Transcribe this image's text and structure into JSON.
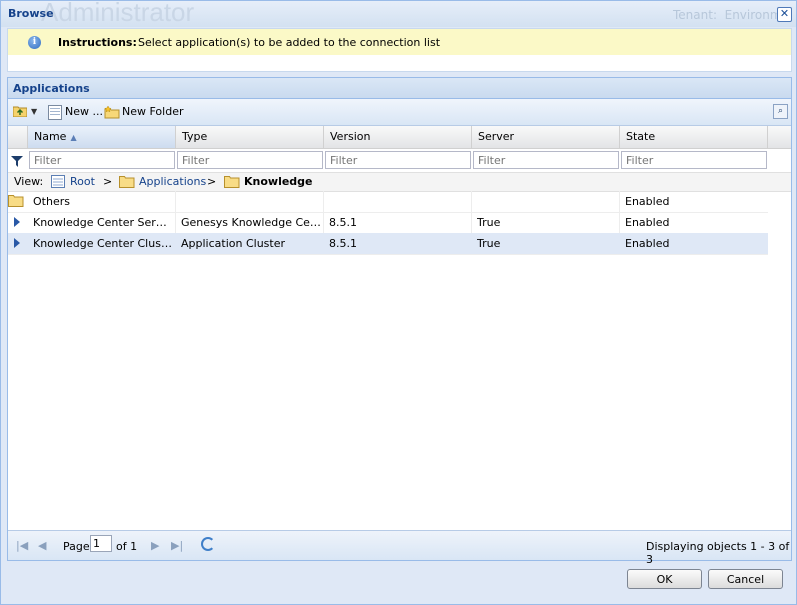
{
  "window": {
    "title": "Browse",
    "background_app_title": "Administrator",
    "background_tenant_text": "Tenant:  Environm",
    "close_glyph": "✕"
  },
  "instructions": {
    "label": "Instructions:",
    "text": "Select application(s) to be added to the connection list"
  },
  "panel": {
    "title": "Applications"
  },
  "toolbar": {
    "new_label": "New ...",
    "new_folder_label": "New Folder"
  },
  "columns": [
    {
      "label": "Name"
    },
    {
      "label": "Type"
    },
    {
      "label": "Version"
    },
    {
      "label": "Server"
    },
    {
      "label": "State"
    }
  ],
  "filters": {
    "placeholder": "Filter"
  },
  "breadcrumb": {
    "view_label": "View:",
    "root": "Root",
    "sep": ">",
    "applications": "Applications",
    "current": "Knowledge"
  },
  "rows": [
    {
      "name": "Others",
      "type": "",
      "version": "",
      "server": "",
      "state": "Enabled"
    },
    {
      "name": "Knowledge Center Server",
      "type": "Genesys Knowledge Cent...",
      "version": "8.5.1",
      "server": "True",
      "state": "Enabled"
    },
    {
      "name": "Knowledge Center Cluster",
      "type": "Application Cluster",
      "version": "8.5.1",
      "server": "True",
      "state": "Enabled"
    }
  ],
  "paging": {
    "page_label": "Page",
    "page_value": "1",
    "of_label": "of 1",
    "display_text": "Displaying objects 1 - 3 of 3"
  },
  "buttons": {
    "ok": "OK",
    "cancel": "Cancel"
  }
}
